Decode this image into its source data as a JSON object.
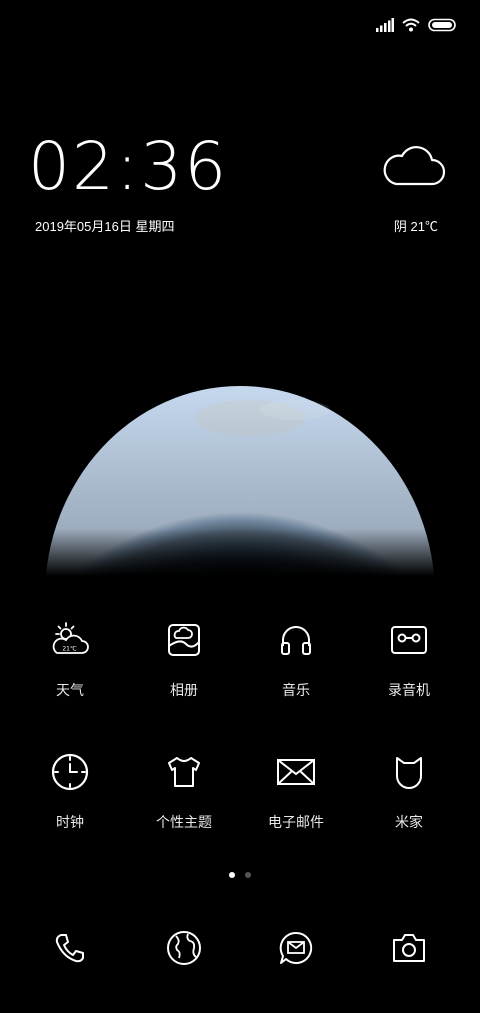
{
  "status": {
    "signal": "signal-icon",
    "wifi": "wifi-icon",
    "battery": "battery-icon"
  },
  "lockscreen": {
    "time": "02:36",
    "date": "2019年05月16日 星期四",
    "weather": {
      "icon": "cloud-icon",
      "text": "阴 21℃"
    }
  },
  "apps_row1": [
    {
      "label": "天气",
      "icon": "weather-icon",
      "badge": "21℃"
    },
    {
      "label": "相册",
      "icon": "gallery-icon"
    },
    {
      "label": "音乐",
      "icon": "headphones-icon"
    },
    {
      "label": "录音机",
      "icon": "recorder-icon"
    }
  ],
  "apps_row2": [
    {
      "label": "时钟",
      "icon": "clock-icon"
    },
    {
      "label": "个性主题",
      "icon": "tshirt-icon"
    },
    {
      "label": "电子邮件",
      "icon": "mail-icon"
    },
    {
      "label": "米家",
      "icon": "mijia-icon"
    }
  ],
  "page_indicator": {
    "pages": 2,
    "current": 1
  },
  "dock": [
    {
      "icon": "phone-icon"
    },
    {
      "icon": "browser-globe-icon"
    },
    {
      "icon": "messages-icon"
    },
    {
      "icon": "camera-icon"
    }
  ]
}
